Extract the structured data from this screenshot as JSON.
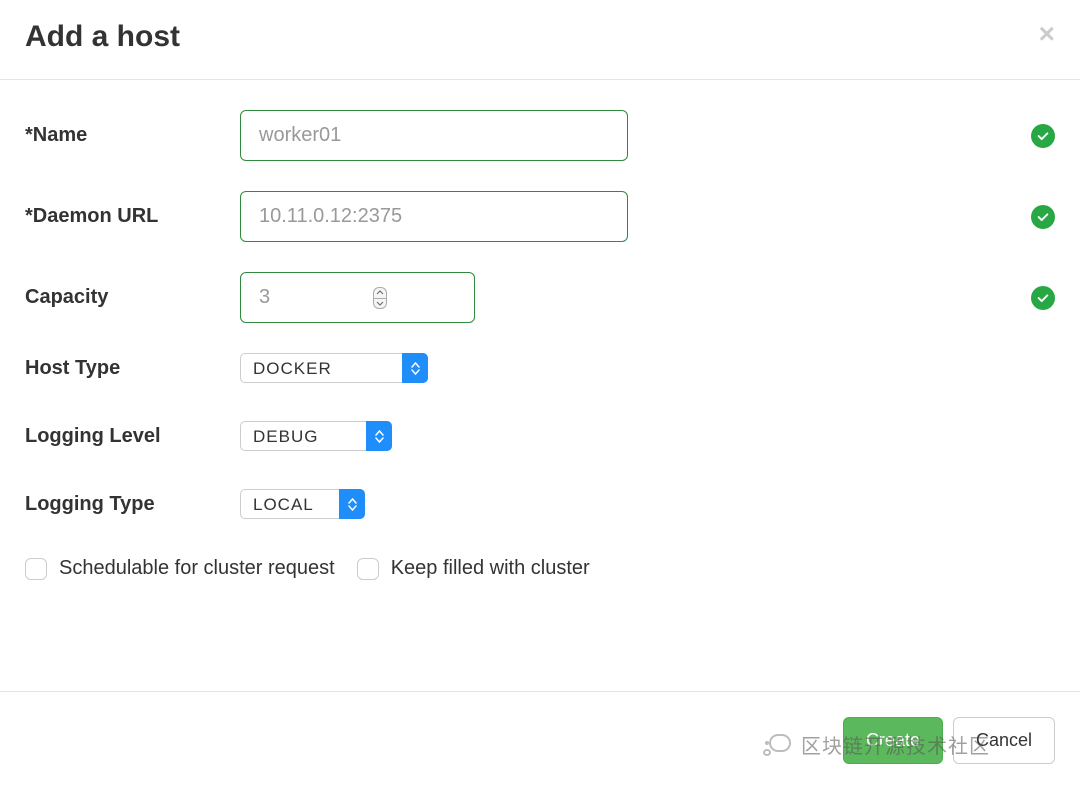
{
  "modal": {
    "title": "Add a host"
  },
  "form": {
    "name": {
      "label": "*Name",
      "value": "worker01",
      "valid": true
    },
    "daemon_url": {
      "label": "*Daemon URL",
      "value": "10.11.0.12:2375",
      "valid": true
    },
    "capacity": {
      "label": "Capacity",
      "value": "3",
      "valid": true
    },
    "host_type": {
      "label": "Host Type",
      "value": "DOCKER"
    },
    "logging_level": {
      "label": "Logging Level",
      "value": "DEBUG"
    },
    "logging_type": {
      "label": "Logging Type",
      "value": "LOCAL"
    },
    "schedulable": {
      "label": "Schedulable for cluster request",
      "checked": false
    },
    "keep_filled": {
      "label": "Keep filled with cluster",
      "checked": false
    }
  },
  "footer": {
    "primary_label": "Create",
    "cancel_label": "Cancel"
  },
  "watermark": {
    "text": "区块链开源技术社区"
  },
  "colors": {
    "success": "#28a745",
    "primary_btn": "#5cb85c",
    "select_accent": "#1f8efa",
    "input_border": "#2f8a3d"
  }
}
